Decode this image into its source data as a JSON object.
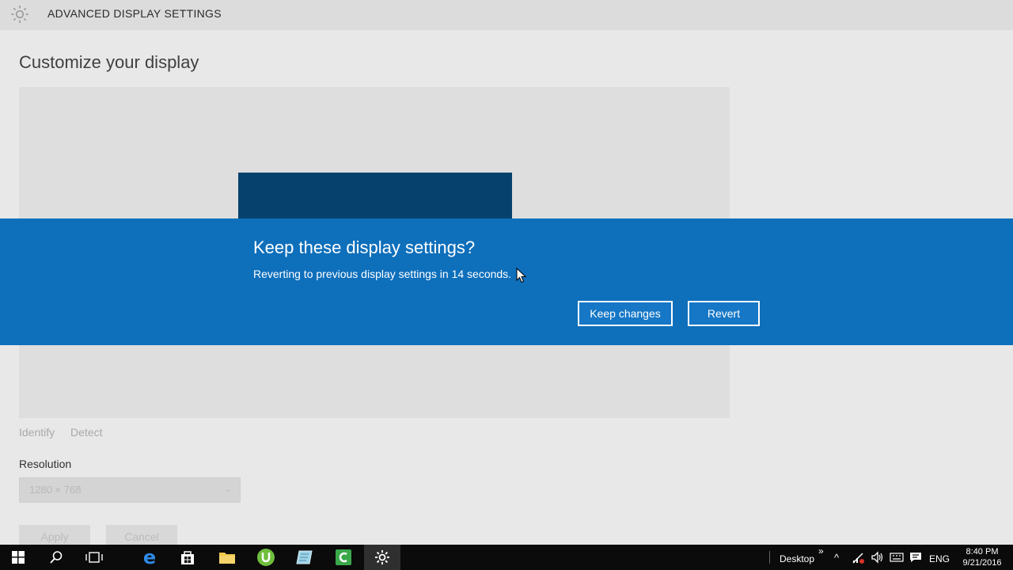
{
  "window": {
    "title": "ADVANCED DISPLAY SETTINGS",
    "heading": "Customize your display"
  },
  "display_links": {
    "identify": "Identify",
    "detect": "Detect"
  },
  "resolution": {
    "label": "Resolution",
    "value": "1280 × 768"
  },
  "actions": {
    "apply": "Apply",
    "cancel": "Cancel"
  },
  "dialog": {
    "title": "Keep these display settings?",
    "message": "Reverting to previous display settings in 14 seconds.",
    "keep_label": "Keep changes",
    "revert_label": "Revert"
  },
  "taskbar": {
    "pinned": [
      "start-icon",
      "search-icon",
      "task-view-icon",
      "edge-icon",
      "store-icon",
      "file-explorer-icon",
      "utorrent-icon",
      "notepad-icon",
      "camtasia-icon",
      "settings-icon"
    ],
    "toolbar_label": "Desktop",
    "language": "ENG",
    "time": "8:40 PM",
    "date": "9/21/2016"
  },
  "colors": {
    "banner": "#0e6fbb",
    "accent_tile": "#06416e",
    "taskbar": "#0b0b0b"
  }
}
